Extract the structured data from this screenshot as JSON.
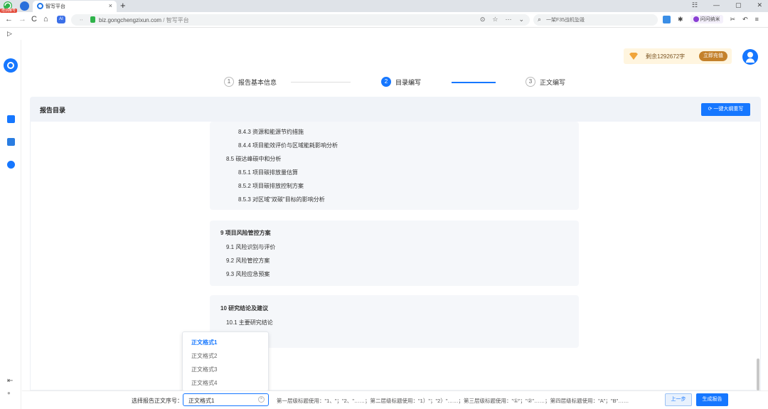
{
  "browser": {
    "badge": "培训推号",
    "tab_title": "智写平台",
    "tab_close": "×",
    "new_tab": "+",
    "url_domain": "biz.gongchengzixun.com",
    "url_path": " / 智写平台",
    "search_placeholder": "一架F35战机坠毁",
    "wenwen_label": "问问纳米",
    "ai_label": "AI",
    "back": "←",
    "forward": "→",
    "reload": "C",
    "home": "⌂",
    "panel_toggle": "▷",
    "win_min": "—",
    "win_max": "▢",
    "win_close": "✕"
  },
  "header": {
    "quota_text": "剩余1292672字",
    "charge_button": "立即充值"
  },
  "steps": [
    {
      "num": "1",
      "label": "报告基本信息"
    },
    {
      "num": "2",
      "label": "目录编写"
    },
    {
      "num": "3",
      "label": "正文编写"
    }
  ],
  "card": {
    "title": "报告目录",
    "rewrite_button": "一键大纲重写"
  },
  "toc": {
    "block1": [
      "8.4.3 资源和能源节约措施",
      "8.4.4 项目能效评价与区域能耗影响分析",
      "8.5 碳达峰碳中和分析",
      "8.5.1 项目碳排放量估算",
      "8.5.2 项目碳排放控制方案",
      "8.5.3 对区域\"双碳\"目标的影响分析"
    ],
    "block2": [
      "9 项目风险管控方案",
      "9.1 风险识别与评价",
      "9.2 风险管控方案",
      "9.3 风险应急预案"
    ],
    "block3": [
      "10 研究结论及建议",
      "10.1 主要研究结论"
    ]
  },
  "dropdown": {
    "options": [
      "正文格式1",
      "正文格式2",
      "正文格式3",
      "正文格式4"
    ],
    "selected_index": 0
  },
  "footer": {
    "format_label": "选择报告正文序号：",
    "format_value": "正文格式1",
    "clear_icon": "×",
    "rules_text": "第一层级标题使用：\"1、\"；\"2、\"……；第二层级标题使用：\"1）\"；\"2）\"……；第三层级标题使用：\"①\"；\"②\"……；第四层级标题使用：\"A\"；\"B\"……",
    "prev_button": "上一步",
    "generate_button": "生成报告"
  }
}
